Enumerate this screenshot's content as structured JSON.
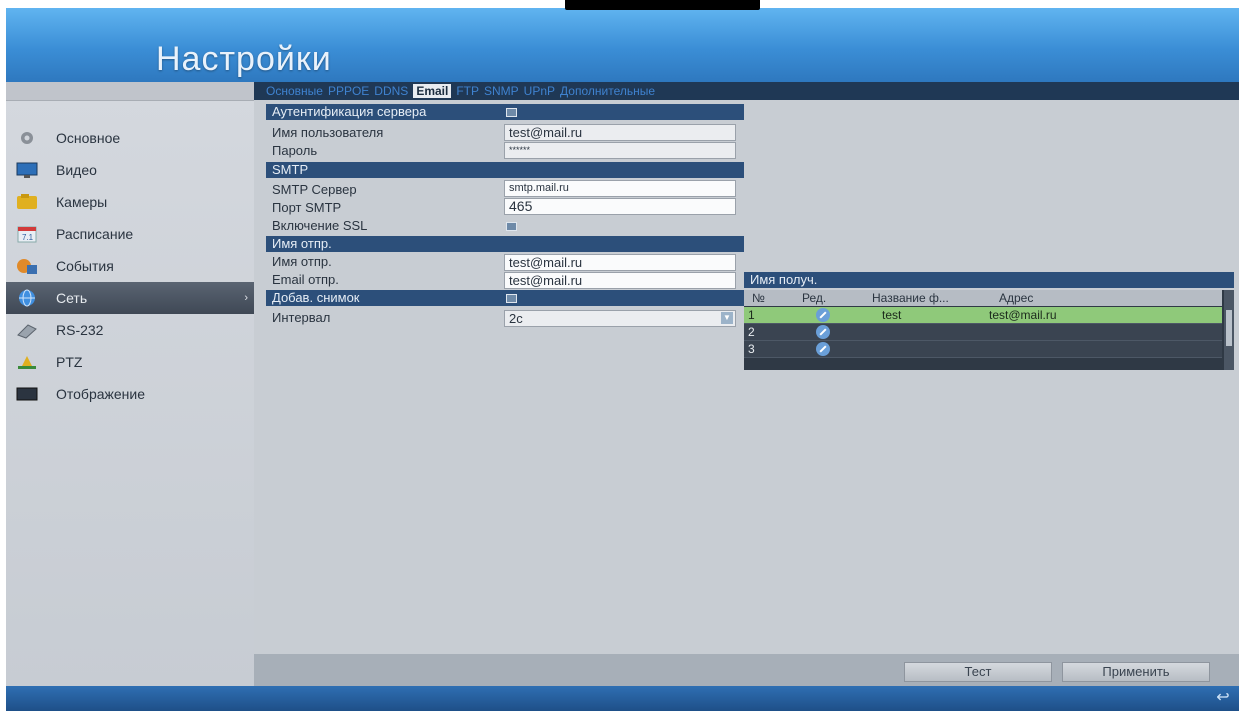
{
  "header": {
    "title": "Настройки"
  },
  "sidebar": {
    "items": [
      {
        "label": "Основное",
        "icon": "gear-icon"
      },
      {
        "label": "Видео",
        "icon": "monitor-icon"
      },
      {
        "label": "Камеры",
        "icon": "camera-icon"
      },
      {
        "label": "Расписание",
        "icon": "calendar-icon"
      },
      {
        "label": "События",
        "icon": "events-icon"
      },
      {
        "label": "Сеть",
        "icon": "network-icon",
        "active": true
      },
      {
        "label": "RS-232",
        "icon": "serial-port-icon"
      },
      {
        "label": "PTZ",
        "icon": "ptz-icon"
      },
      {
        "label": "Отображение",
        "icon": "display-icon"
      }
    ],
    "active_arrow": "›"
  },
  "tabs": [
    "Основные",
    "PPPOE",
    "DDNS",
    "Email",
    "FTP",
    "SNMP",
    "UPnP",
    "Дополнительные"
  ],
  "active_tab": "Email",
  "form": {
    "auth_label": "Аутентификация сервера",
    "username_label": "Имя пользователя",
    "username_value": "test@mail.ru",
    "password_label": "Пароль",
    "password_value": "******",
    "smtp_section": "SMTP",
    "smtp_server_label": "SMTP Сервер",
    "smtp_server_value": "smtp.mail.ru",
    "smtp_port_label": "Порт SMTP",
    "smtp_port_value": "465",
    "ssl_label": "Включение SSL",
    "sender_section": "Имя отпр.",
    "sender_name_label": "Имя отпр.",
    "sender_name_value": "test@mail.ru",
    "sender_email_label": "Email отпр.",
    "sender_email_value": "test@mail.ru",
    "snapshot_label": "Добав. снимок",
    "interval_label": "Интервал",
    "interval_value": "2с"
  },
  "recipients": {
    "section_label": "Имя получ.",
    "columns": [
      "№",
      "Ред.",
      "Название ф...",
      "Адрес"
    ],
    "rows": [
      {
        "no": "1",
        "name": "test",
        "address": "test@mail.ru",
        "selected": true
      },
      {
        "no": "2",
        "name": "",
        "address": ""
      },
      {
        "no": "3",
        "name": "",
        "address": ""
      }
    ]
  },
  "buttons": {
    "test": "Тест",
    "apply": "Применить"
  },
  "colors": {
    "header_blue": "#3b8ed6",
    "section_bar": "#2c4f7a",
    "selected_row": "#8fc97a"
  }
}
